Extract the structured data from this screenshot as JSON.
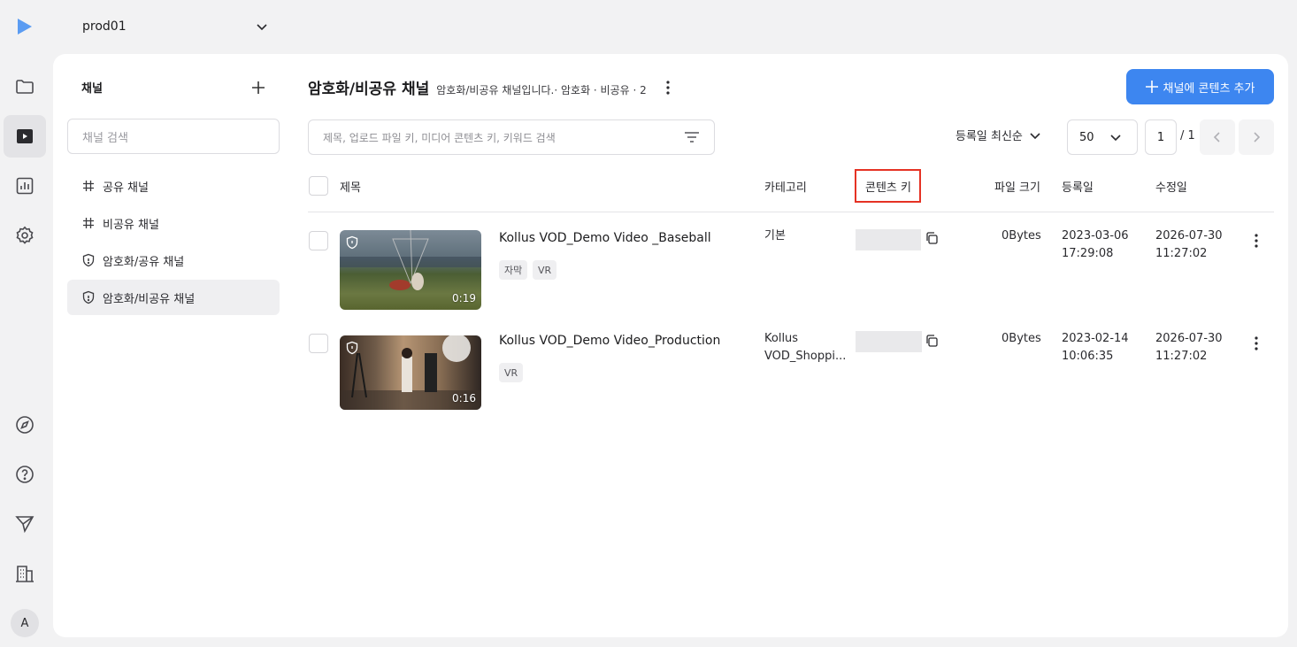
{
  "workspace": {
    "name": "prod01"
  },
  "rail": {
    "items": [
      "folder-icon",
      "video-icon",
      "chart-icon",
      "settings-icon"
    ],
    "bottom": [
      "compass-icon",
      "help-icon",
      "send-icon",
      "building-icon"
    ],
    "avatar": "A"
  },
  "channels": {
    "title": "채널",
    "search_placeholder": "채널 검색",
    "items": [
      {
        "label": "공유 채널",
        "icon": "hash-icon"
      },
      {
        "label": "비공유 채널",
        "icon": "hash-icon"
      },
      {
        "label": "암호화/공유 채널",
        "icon": "shield-icon"
      },
      {
        "label": "암호화/비공유 채널",
        "icon": "shield-icon",
        "active": true
      }
    ]
  },
  "main": {
    "title": "암호화/비공유 채널",
    "description": "암호화/비공유 채널입니다.· 암호화 · 비공유 · 2",
    "add_button": "채널에 콘텐츠 추가",
    "search_placeholder": "제목, 업로드 파일 키, 미디어 콘텐츠 키, 키워드 검색",
    "sort_label": "등록일 최신순",
    "per_page": "50",
    "page_current": "1",
    "page_total": "/ 1"
  },
  "table": {
    "headers": {
      "title": "제목",
      "category": "카테고리",
      "content_key": "콘텐츠 키",
      "file_size": "파일 크기",
      "created": "등록일",
      "modified": "수정일"
    },
    "rows": [
      {
        "title": "Kollus VOD_Demo Video _Baseball",
        "tags": [
          "자막",
          "VR"
        ],
        "duration": "0:19",
        "category": "기본",
        "file_size": "0Bytes",
        "created_date": "2023-03-06",
        "created_time": "17:29:08",
        "modified_date": "2026-07-30",
        "modified_time": "11:27:02"
      },
      {
        "title": "Kollus VOD_Demo Video_Production",
        "tags": [
          "VR"
        ],
        "duration": "0:16",
        "category_line1": "Kollus",
        "category_line2": "VOD_Shoppi...",
        "file_size": "0Bytes",
        "created_date": "2023-02-14",
        "created_time": "10:06:35",
        "modified_date": "2026-07-30",
        "modified_time": "11:27:02"
      }
    ]
  },
  "colors": {
    "accent": "#3d86f0",
    "highlight": "#e53224"
  }
}
